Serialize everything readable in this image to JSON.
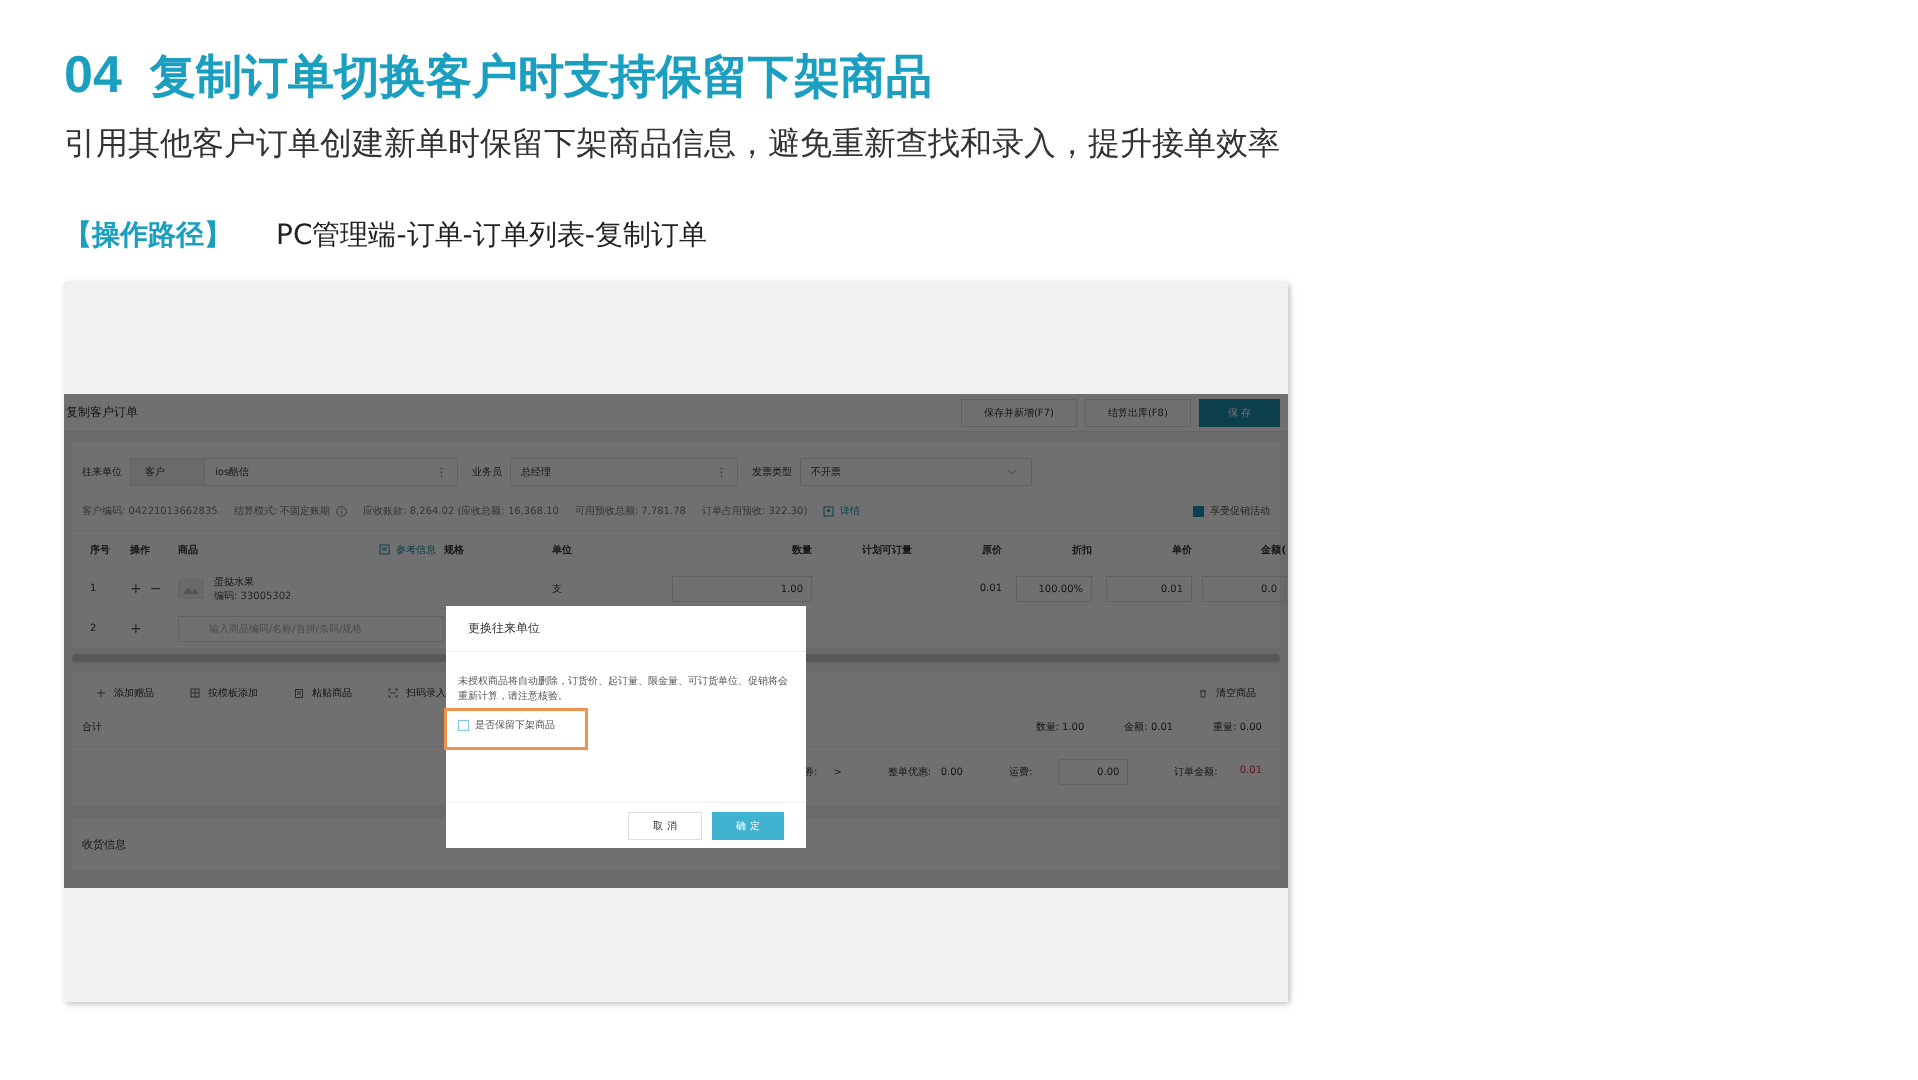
{
  "slide": {
    "number": "04",
    "title": "复制订单切换客户时支持保留下架商品",
    "subtitle": "引用其他客户订单创建新单时保留下架商品信息，避免重新查找和录入，提升接单效率",
    "path_label": "【操作路径】",
    "path": "PC管理端-订单-订单列表-复制订单"
  },
  "app": {
    "title": "复制客户订单",
    "header_buttons": [
      {
        "label": "保存并新增(F7)",
        "kind": "default"
      },
      {
        "label": "结算出库(F8)",
        "kind": "default"
      },
      {
        "label": "保 存",
        "kind": "primary"
      }
    ],
    "form": [
      {
        "label": "往来单位",
        "prefix": "客户",
        "value": "ios酷信",
        "kind": "picker"
      },
      {
        "label": "业务员",
        "value": "总经理",
        "kind": "picker"
      },
      {
        "label": "发票类型",
        "value": "不开票",
        "kind": "select"
      }
    ],
    "info": [
      "客户编码: 04221013662835",
      "结算模式: 不固定账期"
    ],
    "balances": [
      "应收账款: 8,264.02 (应收总额: 16,368.10",
      "可用预收总额: 7,781.78",
      "订单占用预收: 322.30)"
    ],
    "details_link": "详情",
    "promo": {
      "label": "享受促销活动",
      "checked": true
    },
    "columns": [
      "序号",
      "操作",
      "商品",
      "参考信息",
      "规格",
      "单位",
      "数量",
      "计划可订量",
      "原价",
      "折扣",
      "单价",
      "金额("
    ],
    "rows": [
      {
        "kind": "item",
        "index": "1",
        "ops": [
          "+",
          "−"
        ],
        "name": "蛋挞水果",
        "code": "编码: 33005302",
        "unit": "支",
        "qty": "1.00",
        "price": "0.01",
        "discount": "100.00%",
        "unit_price": "0.01",
        "amount": "0.0"
      },
      {
        "kind": "input",
        "index": "2",
        "ops": [
          "+"
        ],
        "placeholder": "输入商品编码/名称/首拼/条码/规格"
      }
    ],
    "tools": [
      "添加赠品",
      "按模板添加",
      "粘贴商品",
      "扫码录入"
    ],
    "clear": "清空商品",
    "total_label": "合计",
    "totals": [
      "数量: 1.00",
      "金额: 0.01",
      "重量: 0.00"
    ],
    "coupon": {
      "label": "券:",
      "value": ">"
    },
    "discount": {
      "label": "整单优惠:",
      "value": "0.00"
    },
    "freight": {
      "label": "运费:",
      "value": "0.00"
    },
    "order_amount": {
      "label": "订单金额:",
      "value": "0.01"
    },
    "shipping": "收货信息"
  },
  "dialog": {
    "title": "更换往来单位",
    "message": "未授权商品将自动删除，订货价、起订量、限金量、可订货单位、促销将会重新计算，请注意核验。",
    "option": {
      "label": "是否保留下架商品",
      "checked": false
    },
    "buttons": [
      {
        "label": "取 消",
        "kind": "default"
      },
      {
        "label": "确 定",
        "kind": "primary"
      }
    ]
  }
}
